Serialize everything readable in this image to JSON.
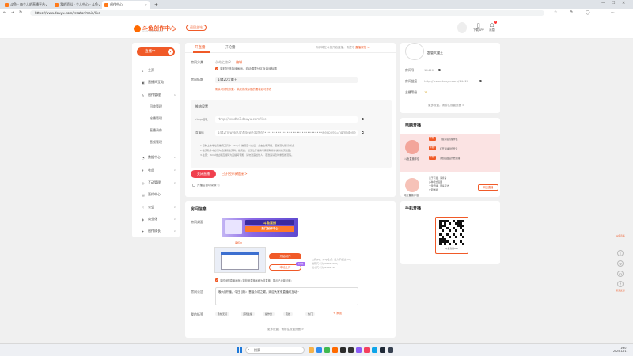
{
  "browser": {
    "tabs": [
      {
        "label": "斗鱼 - 每个人的直播平台",
        "active": false
      },
      {
        "label": "我的资料 - 个人中心 - 斗鱼",
        "active": false
      },
      {
        "label": "创作中心",
        "active": true
      }
    ],
    "url": "https://www.douyu.com/creator/main/live"
  },
  "header": {
    "logo_text": "斗鱼创作中心",
    "logo_sub": "DOUYU CREATOR CENTER",
    "back_label": "返回主站",
    "download_label": "下载APP",
    "message_label": "消息",
    "message_badge": "2"
  },
  "sidebar": {
    "live_button": "直播中",
    "items": [
      {
        "label": "主页",
        "icon": "home-icon"
      },
      {
        "label": "直播间互动",
        "icon": "live-room-icon"
      },
      {
        "label": "创作管理",
        "icon": "creation-icon",
        "expanded": true
      },
      {
        "label": "回放管理",
        "sub": true
      },
      {
        "label": "轮播管理",
        "sub": true
      },
      {
        "label": "直播录像",
        "sub": true
      },
      {
        "label": "音频管理",
        "sub": true
      },
      {
        "label": "数据中心",
        "icon": "data-icon"
      },
      {
        "label": "收益",
        "icon": "income-icon"
      },
      {
        "label": "互动管理",
        "icon": "interact-icon"
      },
      {
        "label": "签约中心",
        "icon": "contract-icon"
      },
      {
        "label": "公会",
        "icon": "guild-icon"
      },
      {
        "label": "商业化",
        "icon": "commerce-icon"
      },
      {
        "label": "创作成长",
        "icon": "growth-icon"
      }
    ]
  },
  "main": {
    "tabs": [
      "开直播",
      "开轮播"
    ],
    "tab_tip": "你即将在斗鱼开启直播，请遵守",
    "tab_tip_link": "直播规范 >",
    "category_label": "房间分类",
    "category_value": "永劫之旅/2",
    "category_edit": "编辑",
    "record_check": "实时识别游戏画面，自动调整分区及游戏标题",
    "title_label": "房间标题",
    "title_value": "14420大魔王",
    "title_hint": "剩余可修改次数：满足修改标题的要求后可修改",
    "push_label": "推流设置",
    "rtmp_label": "rtmp地址",
    "rtmp_value": "rtmp://sendtc3.douyu.com/live",
    "code_label": "直播码",
    "code_value": "1442rnlwyBR4hN4ew7dgf6h?•••••••••••••••••••••••••••••••&expires=ngmhdone",
    "notes": [
      "1.复制上方地址到推流工具中（rtmp）推流至斗鱼后，点击左侧开播，若推流失败请重试。",
      "2.推流软件中必须勾选使用推流码，推流后，如无法开播请与客服联系并提供推流截图。",
      "3.注意：rtmp地址和直播码为直播间专属，请勿泄露给他人，若泄露请及时重置推流码。"
    ],
    "close_button": "关闭直播",
    "share_link": "已开启分享链接 >",
    "record_option": "开播后自动录像"
  },
  "room": {
    "title": "房间信息",
    "cover_label": "房间封面",
    "cover_banner1": "斗鱼直播",
    "cover_banner2": "热门创作中心",
    "cover_status": "审核中",
    "start_button": "开始制作",
    "upload_button": "本地上传",
    "new_badge": "新功能",
    "format_line1": "支持jpg、png格式，最大不超过5M，",
    "format_line2": "推荐尺寸为1920x1080，",
    "format_line3": "最小尺寸为1280x720",
    "auto_capture": "实时截图直播画面（如检测直播画面为非直播，展示已设置封面）",
    "announce_label": "房间公告",
    "announce_text": "晚9点开播，今日目标：晋级永劫之巅，欢迎大家来直播间互动~",
    "tags_label": "我的标签",
    "tags": [
      "永劫无间",
      "游戏主播",
      "操作秀",
      "竞技",
      "热门"
    ],
    "add_tag": "+ 添加",
    "more_settings": "更多设置，请前往设置页面 >"
  },
  "profile": {
    "name": "超管大魔王",
    "room_id_label": "房间号",
    "room_id": "14420",
    "link_label": "房间链接",
    "link": "http://www.douyu.com/14420",
    "level_label": "主播等级",
    "level": "11",
    "more": "更多设置，请前往设置页面 >"
  },
  "guide": {
    "title": "电脑开播",
    "steps": [
      {
        "tag": "步骤1",
        "text": "下载斗鱼直播伴侣"
      },
      {
        "tag": "步骤2",
        "text": "打开直播伴侣登录"
      },
      {
        "tag": "步骤3",
        "text": "添加画面后开始直播"
      }
    ],
    "app_name": "斗鱼直播伴侣",
    "line2": "关于下载，请查看",
    "line2b": "多种模式画面",
    "line2c": "一键开播，更多玩法",
    "line2d": "立即体验",
    "app2_name": "网页直播伴侣",
    "download_button": "网页直播"
  },
  "app": {
    "title": "手机开播",
    "qr_caption": "斗鱼直播APP"
  },
  "rail": {
    "top": "斗鱼直播",
    "bottom": "意见反馈"
  },
  "taskbar": {
    "search_placeholder": "搜索",
    "time": "19:07",
    "date": "2025/12/11"
  }
}
